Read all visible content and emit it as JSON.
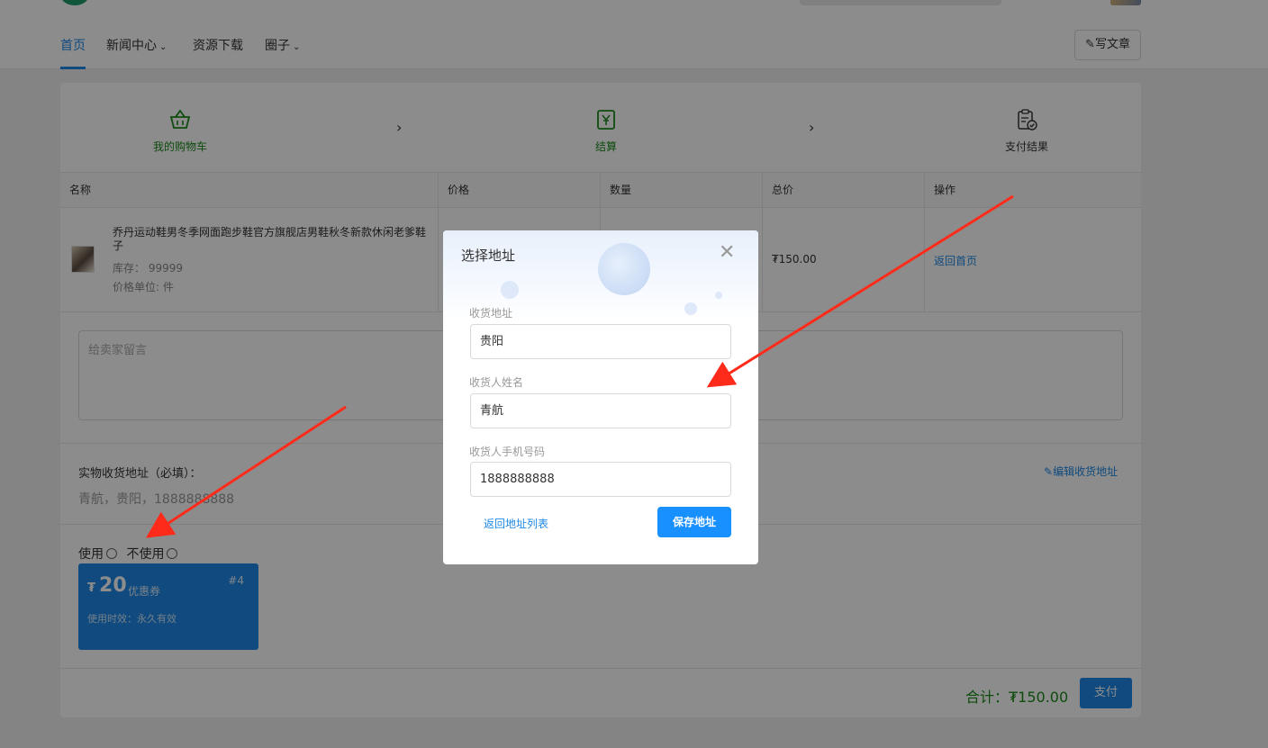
{
  "nav": {
    "items": [
      "首页",
      "新闻中心",
      "资源下载",
      "圈子"
    ],
    "write_button": "写文章"
  },
  "steps": [
    {
      "label": "我的购物车",
      "icon": "basket-icon",
      "color": "#1a8a1a"
    },
    {
      "label": "结算",
      "icon": "yen-receipt-icon",
      "color": "#1a8a1a"
    },
    {
      "label": "支付结果",
      "icon": "clipboard-check-icon",
      "color": "#333333"
    }
  ],
  "table": {
    "headers": [
      "名称",
      "价格",
      "数量",
      "总价",
      "操作"
    ],
    "row": {
      "name": "乔丹运动鞋男冬季网面跑步鞋官方旗舰店男鞋秋冬新款休闲老爹鞋子",
      "stock": "库存： 99999",
      "unit": "价格单位: 件",
      "total": "₮150.00",
      "action": "返回首页"
    }
  },
  "message_placeholder": "给卖家留言",
  "address": {
    "title": "实物收货地址（必填）：",
    "value": "青航，贵阳，1888888888",
    "edit_label": "编辑收货地址"
  },
  "coupon_choice": {
    "use": "使用",
    "not_use": "不使用"
  },
  "coupon": {
    "symbol": "₮",
    "amount": "20",
    "label": "优惠券",
    "number": "#4",
    "validity": "使用时效：永久有效"
  },
  "total": "合计：₮150.00",
  "pay_button": "支付",
  "modal": {
    "title": "选择地址",
    "close": "✕",
    "fields": [
      {
        "label": "收货地址",
        "value": "贵阳"
      },
      {
        "label": "收货人姓名",
        "value": "青航"
      },
      {
        "label": "收货人手机号码",
        "value": "1888888888"
      }
    ],
    "back_link": "返回地址列表",
    "save_button": "保存地址"
  },
  "colors": {
    "accent": "#1e88e5",
    "success": "#1a8a1a",
    "arrow": "#ff2b1a"
  }
}
